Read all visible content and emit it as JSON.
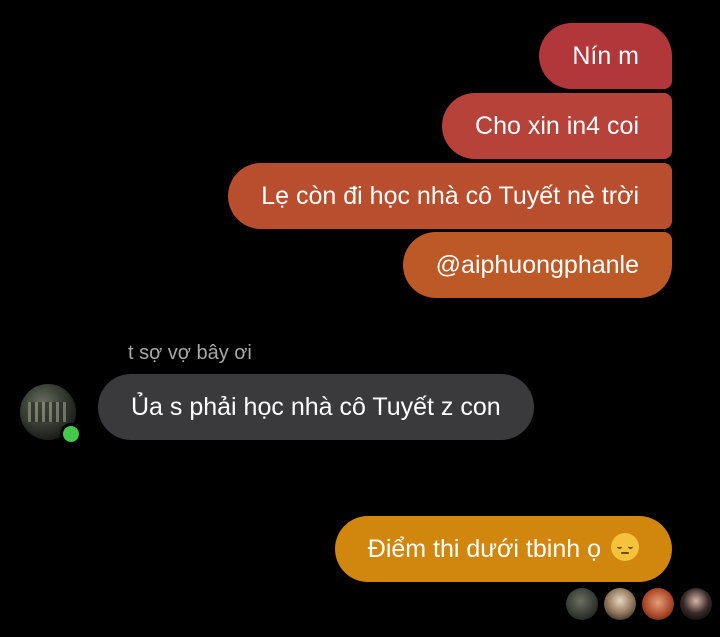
{
  "outgoing_messages": [
    "Nín m",
    "Cho xin in4 coi",
    "Lẹ còn đi học nhà cô Tuyết nè trời",
    "@aiphuongphanle"
  ],
  "incoming": {
    "sender_name": "t sợ vợ bây ơi",
    "message": "Ủa s phải học nhà cô Tuyết z con",
    "avatar_icon": "profile-photo",
    "online": true
  },
  "last_outgoing": {
    "text": "Điểm thi dưới tbinh ọ",
    "emoji": "pensive-face-emoji"
  },
  "seen_by_count": 4,
  "colors": {
    "background": "#000000",
    "incoming_bubble": "#3a3a3c",
    "outgoing_gradient": [
      "#b2373a",
      "#b6423a",
      "#b94e2e",
      "#bc5926",
      "#d1860e"
    ],
    "online_indicator": "#44c94a"
  }
}
